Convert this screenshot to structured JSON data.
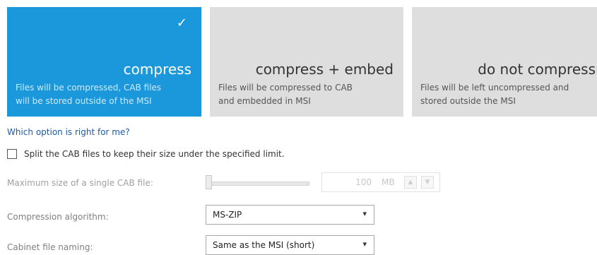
{
  "tiles": [
    {
      "title": "compress",
      "desc_line1": "Files will be compressed, CAB files",
      "desc_line2": "will be stored outside of the MSI",
      "selected": true
    },
    {
      "title": "compress + embed",
      "desc_line1": "Files will be compressed to CAB",
      "desc_line2": "and embedded in MSI",
      "selected": false
    },
    {
      "title": "do not compress",
      "desc_line1": "Files will be left uncompressed and",
      "desc_line2": "stored outside the MSI",
      "selected": false
    }
  ],
  "help_link": "Which option is right for me?",
  "split_checkbox": {
    "label": "Split the CAB files to keep their size under the specified limit.",
    "checked": false
  },
  "max_size": {
    "label": "Maximum size of a single CAB file:",
    "value": "100",
    "unit": "MB",
    "slider_fraction": 0.0
  },
  "compression": {
    "label": "Compression algorithm:",
    "value": "MS-ZIP"
  },
  "naming": {
    "label": "Cabinet file naming:",
    "value": "Same as the MSI (short)"
  },
  "colors": {
    "accent": "#1b98dc",
    "tile_inactive": "#dedede",
    "link": "#1c5aa8"
  }
}
